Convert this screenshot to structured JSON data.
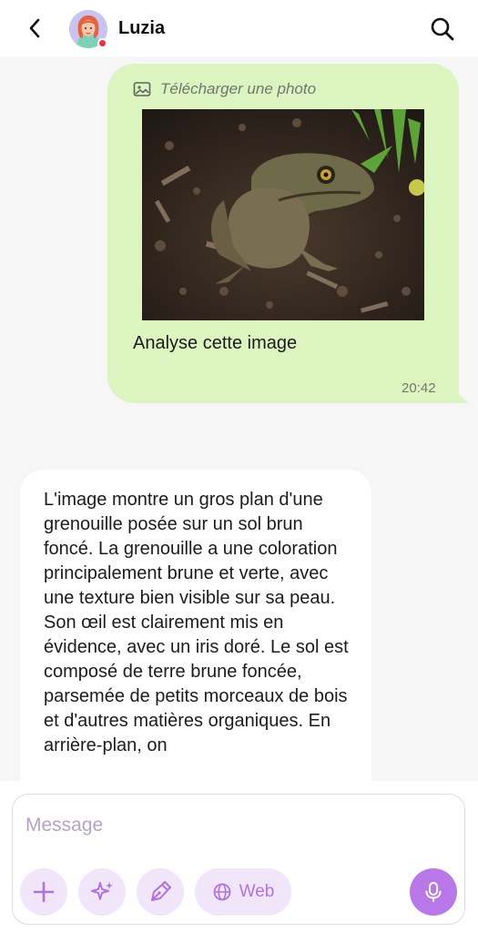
{
  "header": {
    "contact_name": "Luzia",
    "back_icon": "chevron-left-icon",
    "search_icon": "search-icon"
  },
  "outgoing_message": {
    "attachment_label": "Télécharger une photo",
    "attachment_icon": "image-icon",
    "text": "Analyse cette image",
    "time": "20:42",
    "bubble_color": "#dcf4c0"
  },
  "incoming_message": {
    "text": "L'image montre un gros plan d'une grenouille posée sur un sol brun foncé. La grenouille a une coloration principalement brune et verte, avec une texture bien visible sur sa peau. Son œil est clairement mis en évidence, avec un iris doré. Le sol est composé de terre brune foncée, parsemée de petits morceaux de bois et d'autres matières organiques. En arrière-plan, on"
  },
  "composer": {
    "placeholder": "Message",
    "web_label": "Web",
    "accent_color": "#b978e8",
    "chip_color": "#f1e6f9"
  }
}
